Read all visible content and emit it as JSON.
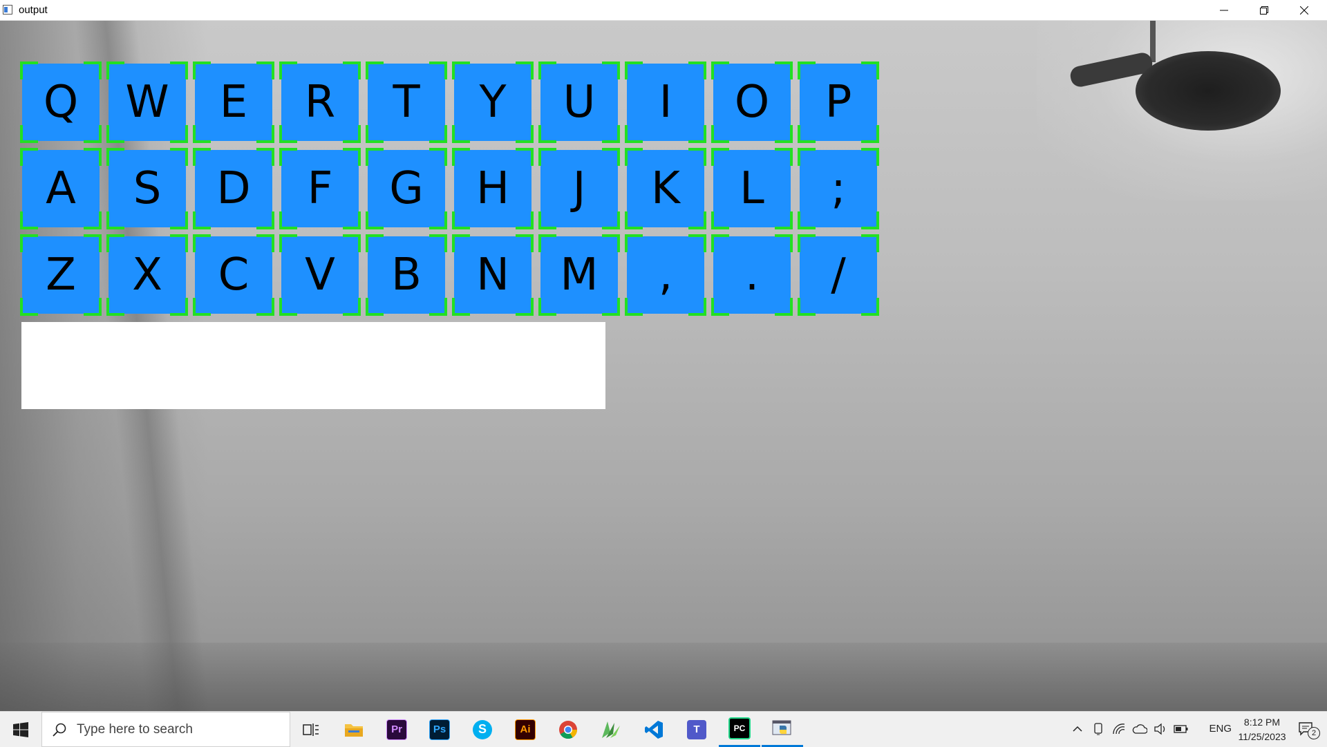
{
  "window": {
    "title": "output"
  },
  "keyboard": {
    "rows": [
      [
        "Q",
        "W",
        "E",
        "R",
        "T",
        "Y",
        "U",
        "I",
        "O",
        "P"
      ],
      [
        "A",
        "S",
        "D",
        "F",
        "G",
        "H",
        "J",
        "K",
        "L",
        ";"
      ],
      [
        "Z",
        "X",
        "C",
        "V",
        "B",
        "N",
        "M",
        ",",
        ".",
        "/"
      ]
    ],
    "key_color": "#1e90ff",
    "corner_color": "#22e022"
  },
  "text_output": {
    "value": ""
  },
  "taskbar": {
    "search_placeholder": "Type here to search",
    "apps": [
      {
        "name": "task-view",
        "label": ""
      },
      {
        "name": "file-explorer",
        "label": ""
      },
      {
        "name": "premiere-pro",
        "label": "Pr"
      },
      {
        "name": "photoshop",
        "label": "Ps"
      },
      {
        "name": "skype",
        "label": "S"
      },
      {
        "name": "illustrator",
        "label": "Ai"
      },
      {
        "name": "chrome",
        "label": ""
      },
      {
        "name": "sheets-app",
        "label": ""
      },
      {
        "name": "vscode",
        "label": ""
      },
      {
        "name": "teams",
        "label": "T"
      },
      {
        "name": "pycharm",
        "label": "PC"
      },
      {
        "name": "python",
        "label": ""
      }
    ],
    "language": "ENG",
    "time": "8:12 PM",
    "date": "11/25/2023",
    "notification_count": "2"
  }
}
